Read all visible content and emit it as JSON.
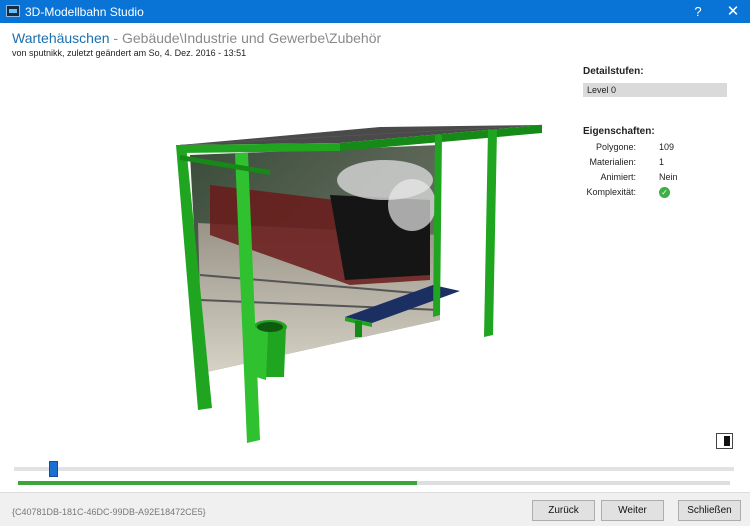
{
  "window": {
    "title": "3D-Modellbahn Studio",
    "help_label": "?",
    "close_label": "✕",
    "icon": "app-icon"
  },
  "header": {
    "name": "Wartehäuschen",
    "path": " - Gebäude\\Industrie und Gewerbe\\Zubehör",
    "subline": "von sputnikk, zuletzt geändert am So, 4. Dez. 2016 - 13:51"
  },
  "details": {
    "heading": "Detailstufen:",
    "level": "Level 0"
  },
  "properties": {
    "heading": "Eigenschaften:",
    "items": [
      {
        "key": "Polygone:",
        "value": "109"
      },
      {
        "key": "Materialien:",
        "value": "1"
      },
      {
        "key": "Animiert:",
        "value": "Nein"
      },
      {
        "key": "Komplexität:",
        "value": "",
        "icon": "check-circle-icon"
      }
    ]
  },
  "colors": {
    "accent": "#0a74d6",
    "frame_green": "#1fa51f",
    "progress_green": "#3aa63a",
    "complexity_ok": "#3cb043"
  },
  "timeline": {
    "slider_position": 0.055,
    "progress": 0.56
  },
  "footer": {
    "guid": "{C40781DB-181C-46DC-99DB-A92E18472CE5}",
    "back_label": "Zurück",
    "next_label": "Weiter",
    "close_label": "Schließen"
  }
}
